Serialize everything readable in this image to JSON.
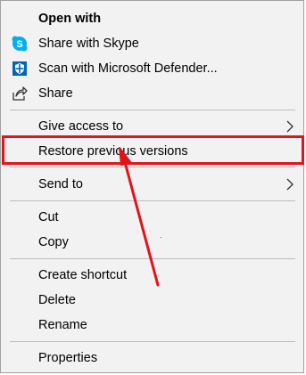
{
  "menu": {
    "open_with": "Open with",
    "share_skype": "Share with Skype",
    "scan_defender": "Scan with Microsoft Defender...",
    "share": "Share",
    "give_access": "Give access to",
    "restore_versions": "Restore previous versions",
    "send_to": "Send to",
    "cut": "Cut",
    "copy": "Copy",
    "create_shortcut": "Create shortcut",
    "delete": "Delete",
    "rename": "Rename",
    "properties": "Properties"
  },
  "icons": {
    "skype": "skype-icon",
    "defender": "defender-shield-icon",
    "share": "share-icon",
    "submenu": "chevron-right-icon"
  },
  "colors": {
    "highlight": "#e1141b",
    "menu_bg": "#f2f2f2",
    "skype_blue": "#00aff0",
    "defender_blue": "#0067b8"
  }
}
